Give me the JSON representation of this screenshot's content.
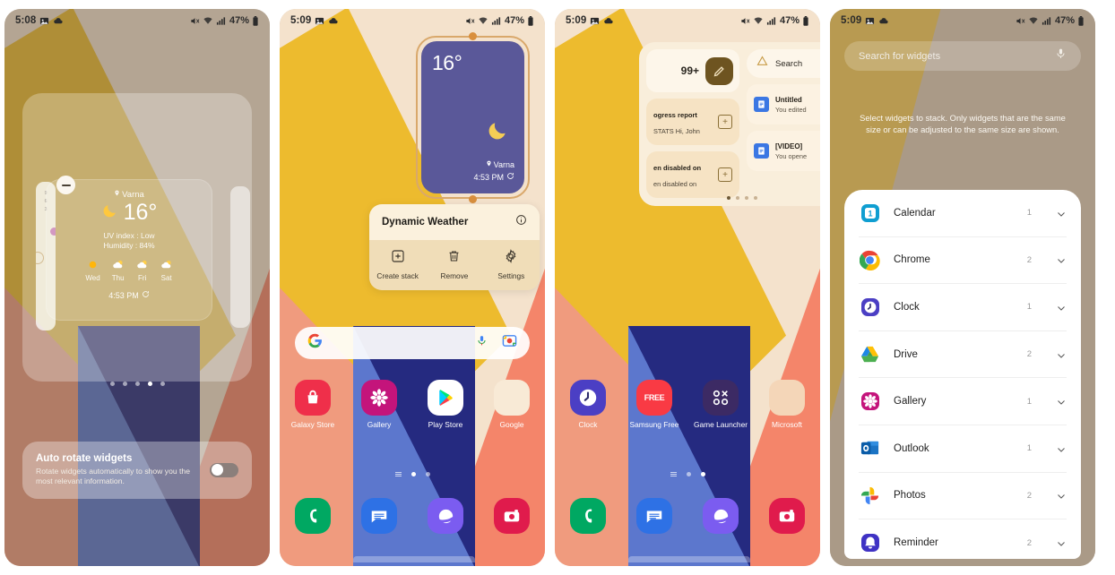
{
  "statusbar": {
    "time_1": "5:08",
    "time_2": "5:09",
    "time_3": "5:09",
    "time_4": "5:09",
    "battery": "47%",
    "icons": [
      "image-icon",
      "cloud-icon",
      "mute-icon",
      "wifi-icon",
      "signal-icon",
      "battery-icon"
    ]
  },
  "panel1": {
    "name": "widget-edit-screen",
    "weather_widget": {
      "location": "Varna",
      "temperature": "16°",
      "condition_icon": "crescent-moon-icon",
      "uv_index": "UV index : Low",
      "humidity": "Humidity : 84%",
      "forecast": [
        {
          "day": "Wed",
          "icon": "sun-icon"
        },
        {
          "day": "Thu",
          "icon": "partly-cloudy-icon"
        },
        {
          "day": "Fri",
          "icon": "partly-cloudy-icon"
        },
        {
          "day": "Sat",
          "icon": "partly-cloudy-icon"
        }
      ],
      "updated_time": "4:53 PM",
      "refresh_icon": "refresh-icon"
    },
    "page_dots": {
      "count": 5,
      "active": 4
    },
    "toast": {
      "title": "Auto rotate widgets",
      "subtitle": "Rotate widgets automatically to show you the most relevant information.",
      "toggle_state": "off"
    }
  },
  "panel2": {
    "name": "widget-selected-screen",
    "weather_widget": {
      "temperature": "16°",
      "condition_icon": "crescent-moon-icon",
      "location": "Varna",
      "updated_time": "4:53 PM",
      "refresh_icon": "refresh-icon"
    },
    "context_menu": {
      "title": "Dynamic Weather",
      "info_icon": "info-icon",
      "actions": [
        {
          "label": "Create stack",
          "icon": "plus-square-icon"
        },
        {
          "label": "Remove",
          "icon": "trash-icon"
        },
        {
          "label": "Settings",
          "icon": "gear-icon"
        }
      ]
    },
    "search_bar": {
      "logo_icon": "google-g-icon",
      "mic_icon": "microphone-icon",
      "lens_icon": "google-lens-icon"
    },
    "apps_row": [
      {
        "label": "Galaxy Store",
        "icon": "galaxy-store-icon"
      },
      {
        "label": "Gallery",
        "icon": "gallery-icon"
      },
      {
        "label": "Play Store",
        "icon": "play-store-icon"
      },
      {
        "label": "Google",
        "icon": "google-folder-icon"
      }
    ],
    "page_dots": {
      "count": 2,
      "active": 1,
      "has_home_bars": true
    },
    "dock": [
      {
        "label": "Phone",
        "icon": "phone-icon"
      },
      {
        "label": "Messages",
        "icon": "messages-icon"
      },
      {
        "label": "Internet",
        "icon": "samsung-internet-icon"
      },
      {
        "label": "Camera",
        "icon": "camera-icon"
      }
    ]
  },
  "panel3": {
    "name": "widget-stack-screen",
    "stack_widget": {
      "left_column": {
        "badge": "99+",
        "compose_icon": "pencil-icon",
        "items": [
          {
            "title": "ogress report",
            "subtitle": "STATS Hi, John",
            "action_icon": "archive-icon"
          },
          {
            "title": "en disabled on",
            "subtitle": "en disabled on",
            "action_icon": "archive-icon"
          }
        ]
      },
      "right_column": {
        "search_label": "Search",
        "search_icon": "google-drive-icon",
        "items": [
          {
            "title": "Untitled",
            "subtitle": "You edited",
            "icon": "google-docs-icon"
          },
          {
            "title": "[VIDEO]",
            "subtitle": "You opene",
            "icon": "google-docs-icon"
          }
        ]
      },
      "page_dots": {
        "count": 4,
        "active": 1
      }
    },
    "apps_row": [
      {
        "label": "Clock",
        "icon": "clock-icon"
      },
      {
        "label": "Samsung Free",
        "icon": "samsung-free-icon"
      },
      {
        "label": "Game Launcher",
        "icon": "game-launcher-icon"
      },
      {
        "label": "Microsoft",
        "icon": "microsoft-folder-icon"
      }
    ],
    "page_dots": {
      "count": 2,
      "active": 2,
      "has_home_bars": true
    },
    "dock": [
      {
        "label": "Phone",
        "icon": "phone-icon"
      },
      {
        "label": "Messages",
        "icon": "messages-icon"
      },
      {
        "label": "Internet",
        "icon": "samsung-internet-icon"
      },
      {
        "label": "Camera",
        "icon": "camera-icon"
      }
    ]
  },
  "panel4": {
    "name": "widget-picker-screen",
    "search": {
      "placeholder": "Search for widgets",
      "mic_icon": "microphone-icon"
    },
    "description": "Select widgets to stack. Only widgets that are the same size or can be adjusted to the same size are shown.",
    "widget_list": [
      {
        "name": "Calendar",
        "count": "1",
        "icon": "calendar-icon"
      },
      {
        "name": "Chrome",
        "count": "2",
        "icon": "chrome-icon"
      },
      {
        "name": "Clock",
        "count": "1",
        "icon": "clock-icon"
      },
      {
        "name": "Drive",
        "count": "2",
        "icon": "google-drive-icon"
      },
      {
        "name": "Gallery",
        "count": "1",
        "icon": "gallery-icon"
      },
      {
        "name": "Outlook",
        "count": "1",
        "icon": "outlook-icon"
      },
      {
        "name": "Photos",
        "count": "2",
        "icon": "google-photos-icon"
      },
      {
        "name": "Reminder",
        "count": "2",
        "icon": "reminder-bell-icon"
      }
    ],
    "chevron_icon": "chevron-down-icon"
  },
  "colors": {
    "wallpaper_yellow": "#edbb2e",
    "wallpaper_cream": "#f4e2cc",
    "wallpaper_salmon": "#f09b7e",
    "wallpaper_coral": "#f4856a",
    "wallpaper_navy": "#252a80",
    "wallpaper_blue": "#5c77cd",
    "widget_purple": "#5a5899",
    "accent_gold": "#d9a86b",
    "moon_yellow": "#f5cd55"
  }
}
